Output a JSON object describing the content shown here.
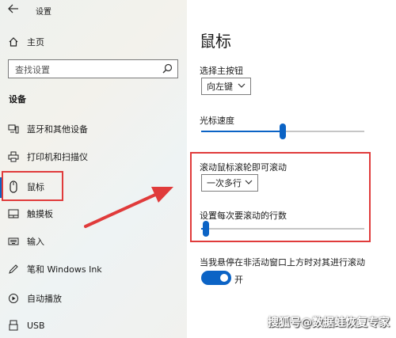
{
  "window": {
    "title": "设置"
  },
  "sidebar": {
    "home_label": "主页",
    "search_placeholder": "查找设置",
    "section_title": "设备",
    "items": [
      {
        "label": "蓝牙和其他设备",
        "icon": "bluetooth-devices-icon"
      },
      {
        "label": "打印机和扫描仪",
        "icon": "printer-icon"
      },
      {
        "label": "鼠标",
        "icon": "mouse-icon",
        "selected": true
      },
      {
        "label": "触摸板",
        "icon": "touchpad-icon"
      },
      {
        "label": "输入",
        "icon": "keyboard-icon"
      },
      {
        "label": "笔和 Windows Ink",
        "icon": "pen-icon"
      },
      {
        "label": "自动播放",
        "icon": "autoplay-icon"
      },
      {
        "label": "USB",
        "icon": "usb-icon"
      }
    ]
  },
  "main": {
    "title": "鼠标",
    "primary_button": {
      "label": "选择主按钮",
      "value": "向左键"
    },
    "cursor_speed": {
      "label": "光标速度",
      "level": 0.5
    },
    "scroll_mode": {
      "label": "滚动鼠标滚轮即可滚动",
      "value": "一次多行"
    },
    "scroll_lines": {
      "label": "设置每次要滚动的行数",
      "level": 0.03
    },
    "inactive_scroll": {
      "label": "当我悬停在非活动窗口上方时对其进行滚动",
      "state": "开"
    }
  },
  "watermark": "搜狐号@数据蛙恢复专家",
  "colors": {
    "accent": "#0b63c5",
    "annotation": "#e03b3b"
  }
}
